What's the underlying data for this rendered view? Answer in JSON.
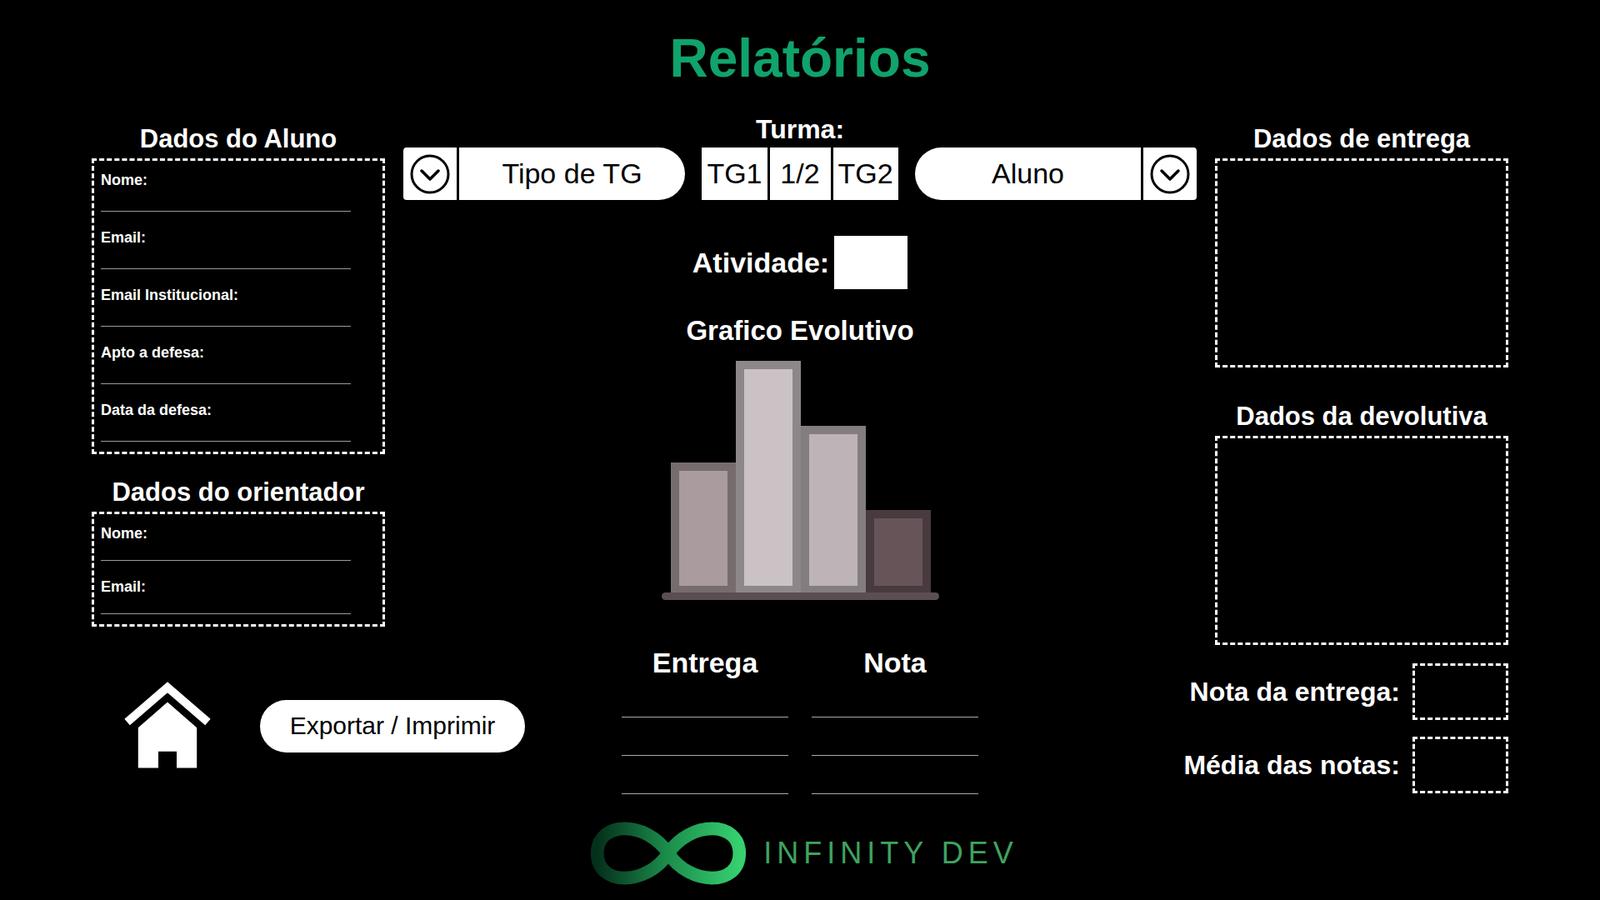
{
  "title": "Relatórios",
  "student": {
    "heading": "Dados do Aluno",
    "fields": [
      {
        "label": "Nome:",
        "value": ""
      },
      {
        "label": "Email:",
        "value": ""
      },
      {
        "label": "Email Institucional:",
        "value": ""
      },
      {
        "label": "Apto a defesa:",
        "value": ""
      },
      {
        "label": "Data da defesa:",
        "value": ""
      }
    ]
  },
  "advisor": {
    "heading": "Dados do orientador",
    "fields": [
      {
        "label": "Nome:",
        "value": ""
      },
      {
        "label": "Email:",
        "value": ""
      }
    ]
  },
  "actions": {
    "export": "Exportar / Imprimir"
  },
  "filters": {
    "type_dropdown": {
      "placeholder": "Tipo de TG",
      "expanded": false
    },
    "class": {
      "label": "Turma:",
      "options": [
        {
          "label": "TG1",
          "selected": false
        },
        {
          "label": "1/2",
          "selected": false
        },
        {
          "label": "TG2",
          "selected": false
        }
      ]
    },
    "student_dropdown": {
      "placeholder": "Aluno",
      "expanded": false
    }
  },
  "activity": {
    "label": "Atividade:",
    "value": ""
  },
  "chart": {
    "title": "Grafico Evolutivo",
    "bars": [
      {
        "value": 129,
        "color": "#a99b9e"
      },
      {
        "value": 229,
        "color": "#cbc2c5"
      },
      {
        "value": 165,
        "color": "#beb3b6"
      },
      {
        "value": 83,
        "color": "#675459"
      }
    ]
  },
  "grades": {
    "columns": [
      "Entrega",
      "Nota"
    ],
    "rows": [
      [
        "",
        ""
      ],
      [
        "",
        ""
      ],
      [
        "",
        ""
      ]
    ]
  },
  "delivery": {
    "heading": "Dados de entrega",
    "content": ""
  },
  "feedback": {
    "heading": "Dados da devolutiva",
    "content": ""
  },
  "summary": [
    {
      "label": "Nota da entrega:",
      "value": ""
    },
    {
      "label": "Média das notas:",
      "value": ""
    }
  ],
  "brand": {
    "name": "INFINITY DEV"
  }
}
